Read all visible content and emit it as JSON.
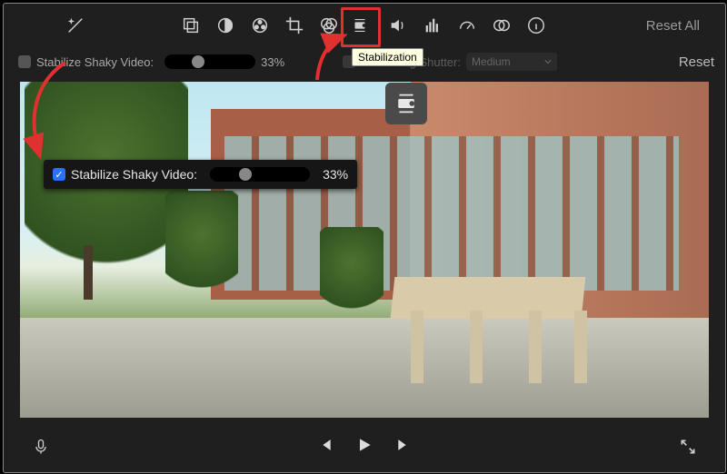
{
  "toolbar": {
    "reset_all": "Reset All"
  },
  "settings": {
    "stabilize_label": "Stabilize Shaky Video:",
    "stabilize_percent": "33%",
    "rolling_label": "Fix Rolling Shutter:",
    "rolling_value": "Medium",
    "reset": "Reset"
  },
  "tooltip": {
    "stabilization": "Stabilization"
  },
  "callout": {
    "stabilize_label": "Stabilize Shaky Video:",
    "stabilize_percent": "33%"
  }
}
